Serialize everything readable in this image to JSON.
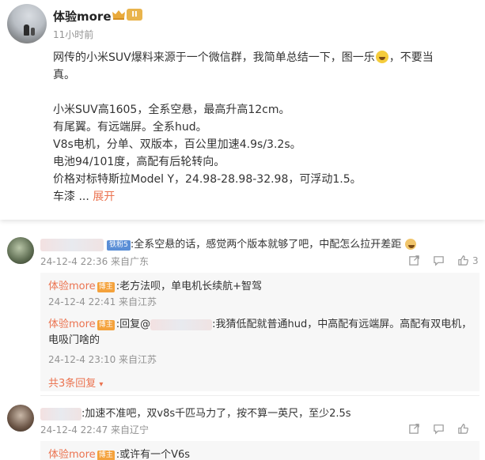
{
  "post": {
    "username": "体验more",
    "level_badge": "II",
    "time": "11小时前",
    "lines": [
      "网传的小米SUV爆料来源于一个微信群，我简单总结一下，图一乐",
      "，不要当",
      "真。",
      "小米SUV高1605，全系空悬，最高升高12cm。",
      "有尾翼。有远端屏。全系hud。",
      "V8s电机，分单、双版本，百公里加速4.9s/3.2s。",
      "电池94/101度，高配有后轮转向。",
      "价格对标特斯拉Model Y，24.98-28.98-32.98，可浮动1.5。",
      "车漆 ..."
    ],
    "expand_label": "展开"
  },
  "comments": [
    {
      "badge": "铁粉5",
      "text": ":全系空悬的话，感觉两个版本就够了吧，中配怎么拉开差距",
      "meta": "24-12-4 22:36 来自广东",
      "like_count": "3",
      "replies": [
        {
          "author": "体验more",
          "tag": "博主",
          "text": ":老方法呗，单电机长续航+智驾",
          "meta": "24-12-4 22:41 来自江苏"
        },
        {
          "author": "体验more",
          "tag": "博主",
          "text_prefix": ":回复@",
          "text": ":我猜低配就普通hud，中高配有远端屏。高配有双电机，",
          "text2": "电吸门啥的",
          "meta": "24-12-4 23:10 来自江苏"
        }
      ],
      "more_replies": "共3条回复"
    },
    {
      "text": ":加速不准吧，双v8s千匹马力了，按不算一英尺，至少2.5s",
      "meta": "24-12-4 22:47 来自辽宁",
      "replies": [
        {
          "author": "体验more",
          "tag": "博主",
          "text": ":或许有一个V6s"
        }
      ]
    }
  ],
  "colors": {
    "accent": "#eb7350",
    "meta": "#939393",
    "reply_bg": "#f7f7f7",
    "badge_blue": "#5a8ed6"
  }
}
